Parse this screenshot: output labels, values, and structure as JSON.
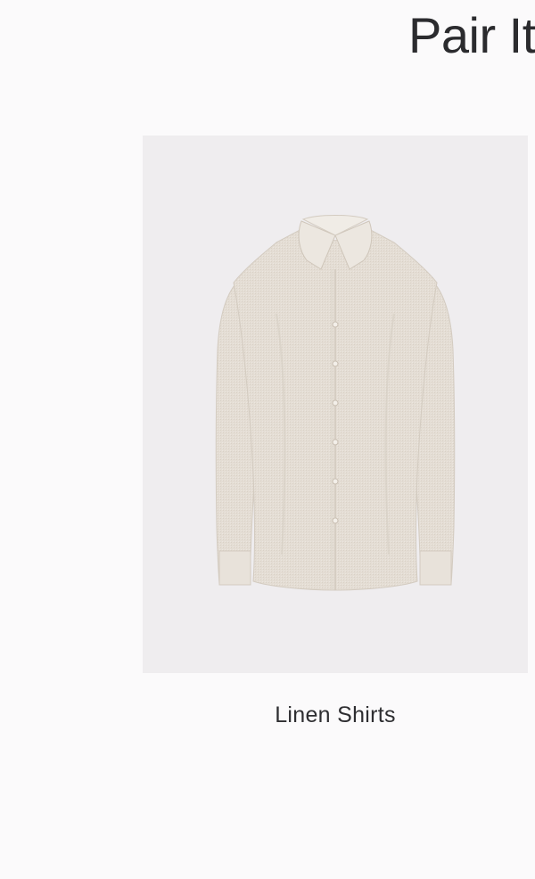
{
  "section": {
    "title": "Pair It"
  },
  "product": {
    "name": "Linen Shirts",
    "image_subject": "shirt-illustration"
  },
  "colors": {
    "background": "#fbfafb",
    "image_background": "#efedef",
    "shirt_fabric": "#e4ddd4",
    "text": "#2b2b2e"
  }
}
